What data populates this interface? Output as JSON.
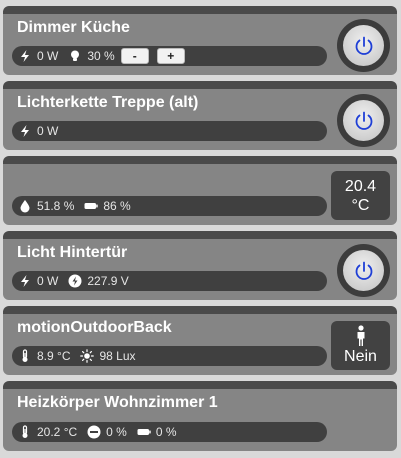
{
  "colors": {
    "card_bg": "#858585",
    "card_header": "#4a4a4a",
    "status_bar": "#404040",
    "power_icon": "#1f3fd6"
  },
  "cards": [
    {
      "title": "Dimmer Küche",
      "status": [
        {
          "icon": "lightning-icon",
          "text": "0 W"
        },
        {
          "icon": "bulb-icon",
          "text": "30 %"
        }
      ],
      "minus_label": "-",
      "plus_label": "+",
      "control": "power-icon"
    },
    {
      "title": "Lichterkette Treppe (alt)",
      "status": [
        {
          "icon": "lightning-icon",
          "text": "0 W"
        }
      ],
      "control": "power-icon"
    },
    {
      "title": "",
      "status": [
        {
          "icon": "droplet-icon",
          "text": "51.8 %"
        },
        {
          "icon": "battery-icon",
          "text": "86 %"
        }
      ],
      "value": "20.4",
      "unit": "°C"
    },
    {
      "title": "Licht Hintertür",
      "status": [
        {
          "icon": "lightning-icon",
          "text": "0 W"
        },
        {
          "icon": "voltage-icon",
          "text": "227.9 V"
        }
      ],
      "control": "power-icon"
    },
    {
      "title": "motionOutdoorBack",
      "status": [
        {
          "icon": "thermometer-icon",
          "text": "8.9 °C"
        },
        {
          "icon": "sun-icon",
          "text": "98 Lux"
        }
      ],
      "presence_icon": "person-icon",
      "presence_text": "Nein"
    },
    {
      "title": "Heizkörper Wohnzimmer 1",
      "status": [
        {
          "icon": "thermometer-icon",
          "text": "20.2 °C"
        },
        {
          "icon": "valve-icon",
          "text": "0 %"
        },
        {
          "icon": "battery-icon",
          "text": "0 %"
        }
      ]
    }
  ]
}
